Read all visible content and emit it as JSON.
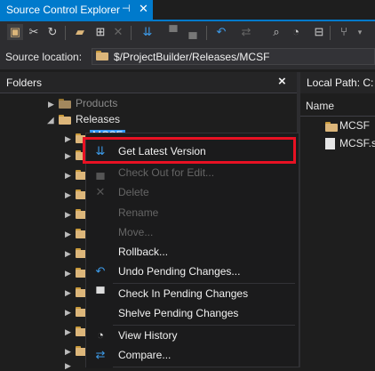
{
  "window": {
    "title": "Source Control Explorer",
    "pin_icon": "pin-icon",
    "close_icon": "close-icon"
  },
  "toolbar": {
    "icons": [
      "workspace-icon",
      "disconnect-icon",
      "refresh-icon",
      "new-folder-icon",
      "add-items-icon",
      "delete-icon",
      "get-latest-icon",
      "checkin-icon",
      "checkout-icon",
      "undo-icon",
      "compare-icon",
      "find-icon",
      "history-icon",
      "branch-icon",
      "merge-icon",
      "dropdown-icon"
    ]
  },
  "location": {
    "label": "Source location:",
    "value": "$/ProjectBuilder/Releases/MCSF"
  },
  "folders_pane": {
    "title": "Folders",
    "close": "×",
    "tree": [
      {
        "label": "Products"
      },
      {
        "label": "Releases"
      },
      {
        "label": "MCSF"
      }
    ]
  },
  "right_pane": {
    "local_path_label": "Local Path:",
    "local_path_value": "C:",
    "column_name": "Name",
    "items": [
      "MCSF",
      "MCSF.sl"
    ]
  },
  "context_menu": {
    "items": [
      {
        "label": "Get Latest Version",
        "icon": "get-latest-icon",
        "enabled": true
      },
      {
        "label": "Check Out for Edit...",
        "icon": "checkout-icon",
        "enabled": false
      },
      {
        "label": "Delete",
        "icon": "delete-icon",
        "enabled": false
      },
      {
        "label": "Rename",
        "icon": "",
        "enabled": false
      },
      {
        "label": "Move...",
        "icon": "",
        "enabled": false
      },
      {
        "label": "Rollback...",
        "icon": "",
        "enabled": true
      },
      {
        "label": "Undo Pending Changes...",
        "icon": "undo-icon",
        "enabled": true
      },
      {
        "label": "Check In Pending Changes",
        "icon": "checkin-icon",
        "enabled": true
      },
      {
        "label": "Shelve Pending Changes",
        "icon": "",
        "enabled": true
      },
      {
        "label": "View History",
        "icon": "history-icon",
        "enabled": true
      },
      {
        "label": "Compare...",
        "icon": "compare-icon",
        "enabled": true
      }
    ]
  },
  "colors": {
    "accent": "#007acc",
    "highlight_box": "#e81123",
    "selected_item": "#3399ff"
  }
}
